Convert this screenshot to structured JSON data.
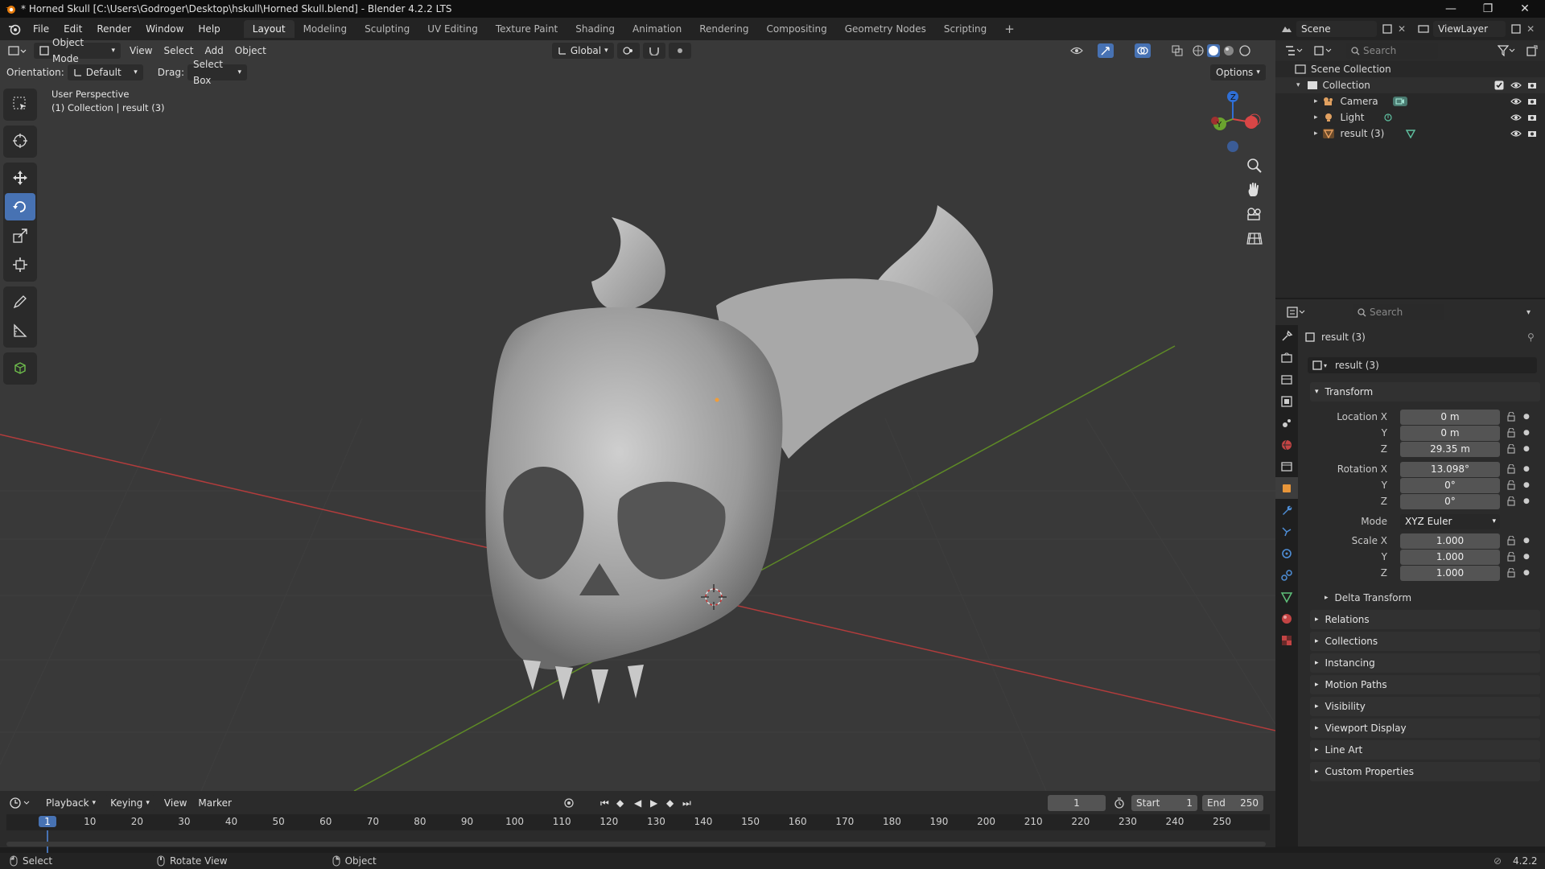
{
  "window": {
    "title": "* Horned Skull [C:\\Users\\Godroger\\Desktop\\hskull\\Horned Skull.blend] - Blender 4.2.2 LTS",
    "minimize": "—",
    "maximize": "❐",
    "close": "✕"
  },
  "menu": [
    "File",
    "Edit",
    "Render",
    "Window",
    "Help"
  ],
  "workspaces": [
    "Layout",
    "Modeling",
    "Sculpting",
    "UV Editing",
    "Texture Paint",
    "Shading",
    "Animation",
    "Rendering",
    "Compositing",
    "Geometry Nodes",
    "Scripting"
  ],
  "active_workspace": "Layout",
  "scene": {
    "name": "Scene",
    "view_layer": "ViewLayer"
  },
  "viewport": {
    "mode": "Object Mode",
    "menus": [
      "View",
      "Select",
      "Add",
      "Object"
    ],
    "transform_orientation": "Global",
    "orientation_label": "Orientation:",
    "orientation_value": "Default",
    "drag_label": "Drag:",
    "drag_value": "Select Box",
    "options": "Options",
    "overlay_line1": "User Perspective",
    "overlay_line2": "(1) Collection | result (3)",
    "gizmo": {
      "x": "X",
      "y": "Y",
      "z": "Z"
    }
  },
  "outliner": {
    "search_placeholder": "Search",
    "root": "Scene Collection",
    "collection": "Collection",
    "items": [
      "Camera",
      "Light",
      "result (3)"
    ]
  },
  "properties": {
    "search_placeholder": "Search",
    "object_name": "result (3)",
    "datablock": "result (3)",
    "transform_label": "Transform",
    "location": {
      "label": "Location X",
      "x": "0 m",
      "y": "0 m",
      "z": "29.35 m"
    },
    "rotation": {
      "label": "Rotation X",
      "x": "13.098°",
      "y": "0°",
      "z": "0°"
    },
    "mode_label": "Mode",
    "mode_value": "XYZ Euler",
    "scale": {
      "label": "Scale X",
      "x": "1.000",
      "y": "1.000",
      "z": "1.000"
    },
    "axis_y": "Y",
    "axis_z": "Z",
    "delta": "Delta Transform",
    "panels": [
      "Relations",
      "Collections",
      "Instancing",
      "Motion Paths",
      "Visibility",
      "Viewport Display",
      "Line Art",
      "Custom Properties"
    ]
  },
  "timeline": {
    "menus": [
      "Playback",
      "Keying",
      "View",
      "Marker"
    ],
    "current_frame": "1",
    "start_label": "Start",
    "start": "1",
    "end_label": "End",
    "end": "250",
    "ticks": [
      "1",
      "10",
      "20",
      "30",
      "40",
      "50",
      "60",
      "70",
      "80",
      "90",
      "100",
      "110",
      "120",
      "130",
      "140",
      "150",
      "160",
      "170",
      "180",
      "190",
      "200",
      "210",
      "220",
      "230",
      "240",
      "250"
    ]
  },
  "status": {
    "select": "Select",
    "rotate": "Rotate View",
    "object": "Object",
    "version": "4.2.2"
  }
}
